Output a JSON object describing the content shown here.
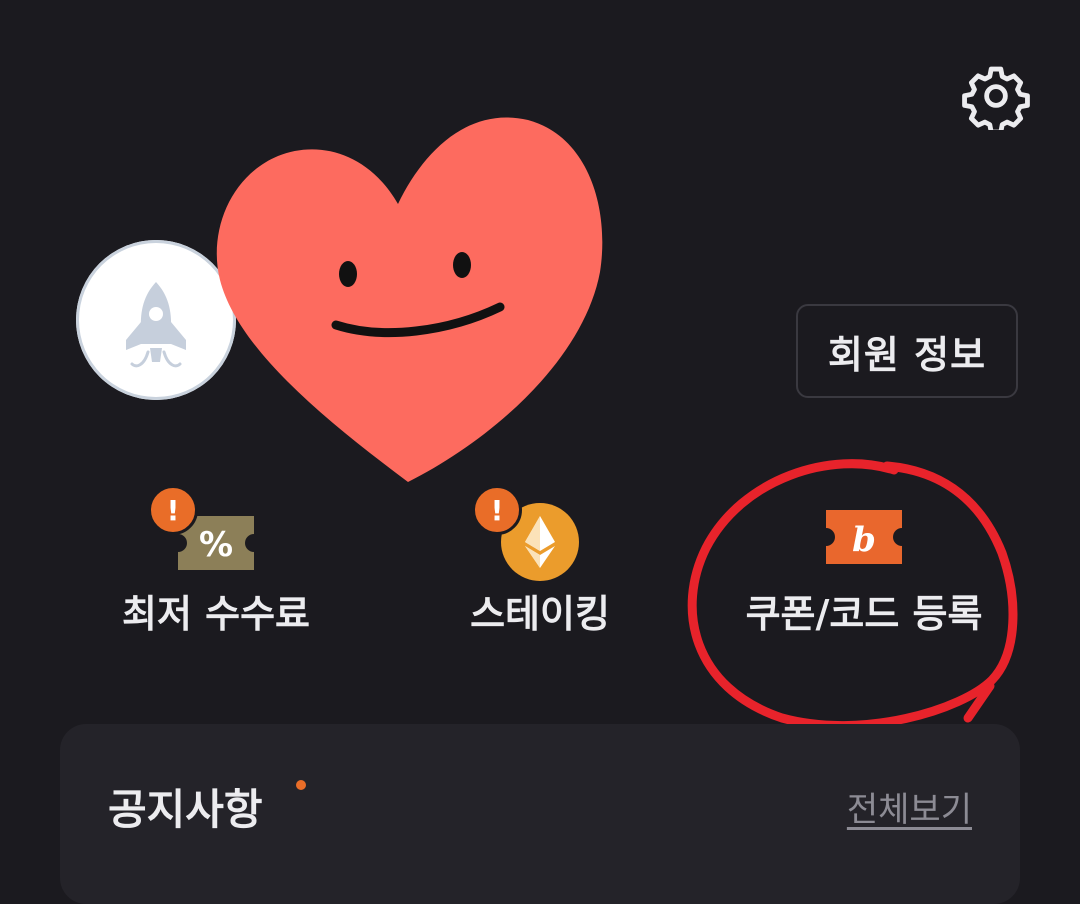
{
  "header": {
    "settings_icon": "gear-icon"
  },
  "profile": {
    "avatar_icon": "rocket-icon",
    "sticker_icon": "heart-face-sticker",
    "member_info_label": "회원 정보"
  },
  "quick_menu": {
    "items": [
      {
        "label": "최저 수수료",
        "icon": "percent-ticket-icon",
        "alert": "!"
      },
      {
        "label": "스테이킹",
        "icon": "ethereum-coin-icon",
        "alert": "!"
      },
      {
        "label": "쿠폰/코드 등록",
        "icon": "b-coupon-icon"
      }
    ]
  },
  "notice": {
    "title": "공지사항",
    "view_all_label": "전체보기"
  },
  "colors": {
    "background": "#1b1a1f",
    "card": "#242329",
    "accent": "#e96d28",
    "heart": "#fd6b5f",
    "annotation": "#e8232b"
  }
}
